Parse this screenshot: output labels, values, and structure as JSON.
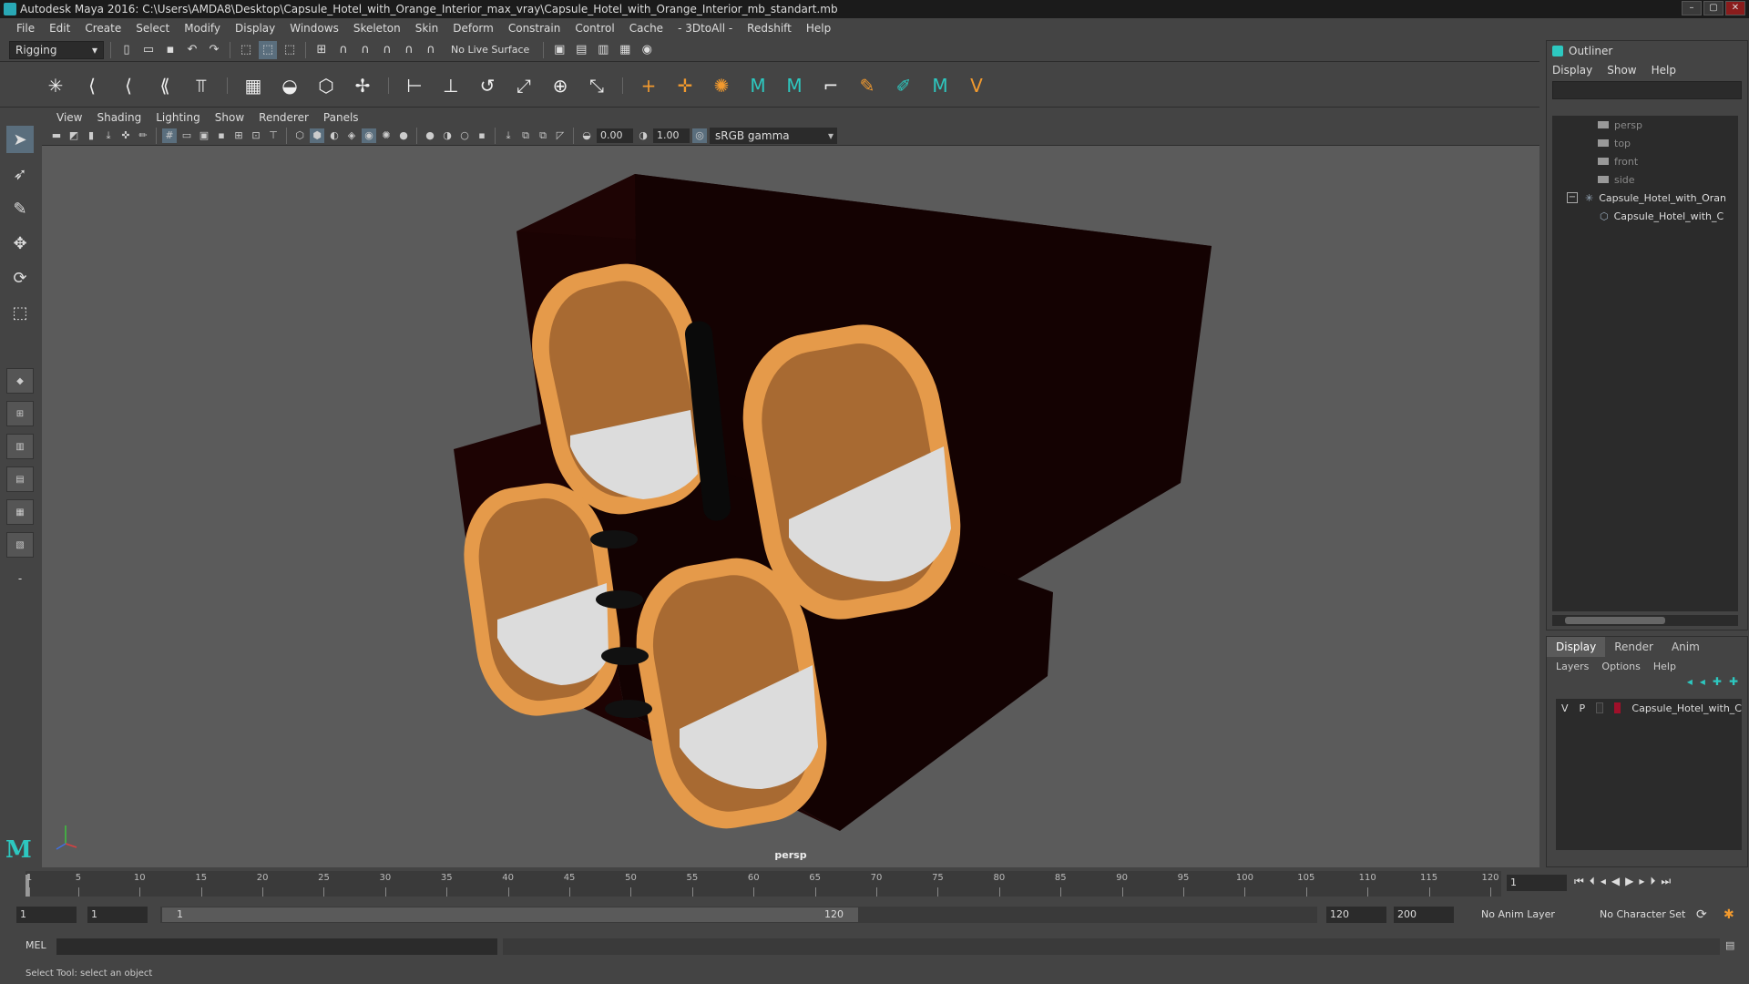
{
  "window": {
    "title": "Autodesk Maya 2016: C:\\Users\\AMDA8\\Desktop\\Capsule_Hotel_with_Orange_Interior_max_vray\\Capsule_Hotel_with_Orange_Interior_mb_standart.mb",
    "controls": [
      "–",
      "▢",
      "✕"
    ]
  },
  "menubar": [
    "File",
    "Edit",
    "Create",
    "Select",
    "Modify",
    "Display",
    "Windows",
    "Skeleton",
    "Skin",
    "Deform",
    "Constrain",
    "Control",
    "Cache",
    "- 3DtoAll -",
    "Redshift",
    "Help"
  ],
  "statusline": {
    "menuset": "Rigging",
    "live_surface": "No Live Surface"
  },
  "panel": {
    "menus": [
      "View",
      "Shading",
      "Lighting",
      "Show",
      "Renderer",
      "Panels"
    ],
    "exposure": "0.00",
    "gamma": "1.00",
    "colorspace": "sRGB gamma",
    "camera": "persp"
  },
  "outliner": {
    "title": "Outliner",
    "menus": [
      "Display",
      "Show",
      "Help"
    ],
    "items": [
      "persp",
      "top",
      "front",
      "side",
      "Capsule_Hotel_with_Oran",
      "Capsule_Hotel_with_C"
    ]
  },
  "layer_editor": {
    "tabs": [
      "Display",
      "Render",
      "Anim"
    ],
    "menus": [
      "Layers",
      "Options",
      "Help"
    ],
    "layer": {
      "v": "V",
      "p": "P",
      "name": "Capsule_Hotel_with_C",
      "color": "#a0102a"
    }
  },
  "timeslider": {
    "ticks": [
      "1",
      "5",
      "10",
      "15",
      "20",
      "25",
      "30",
      "35",
      "40",
      "45",
      "50",
      "55",
      "60",
      "65",
      "70",
      "75",
      "80",
      "85",
      "90",
      "95",
      "100",
      "105",
      "110",
      "115",
      "120"
    ],
    "current_frame": "1"
  },
  "range": {
    "start": "1",
    "playback_start": "1",
    "bar_start": "1",
    "bar_end": "120",
    "playback_end": "120",
    "end": "200",
    "anim_layer": "No Anim Layer",
    "character_set": "No Character Set"
  },
  "cmdline": {
    "label": "MEL"
  },
  "helpline": {
    "text": "Select Tool: select an object"
  },
  "colors": {
    "accent": "#2dc8c0",
    "capsule_frame": "#e59a4a",
    "capsule_body": "#1a0303",
    "viewport_bg": "#5b5b5b"
  }
}
